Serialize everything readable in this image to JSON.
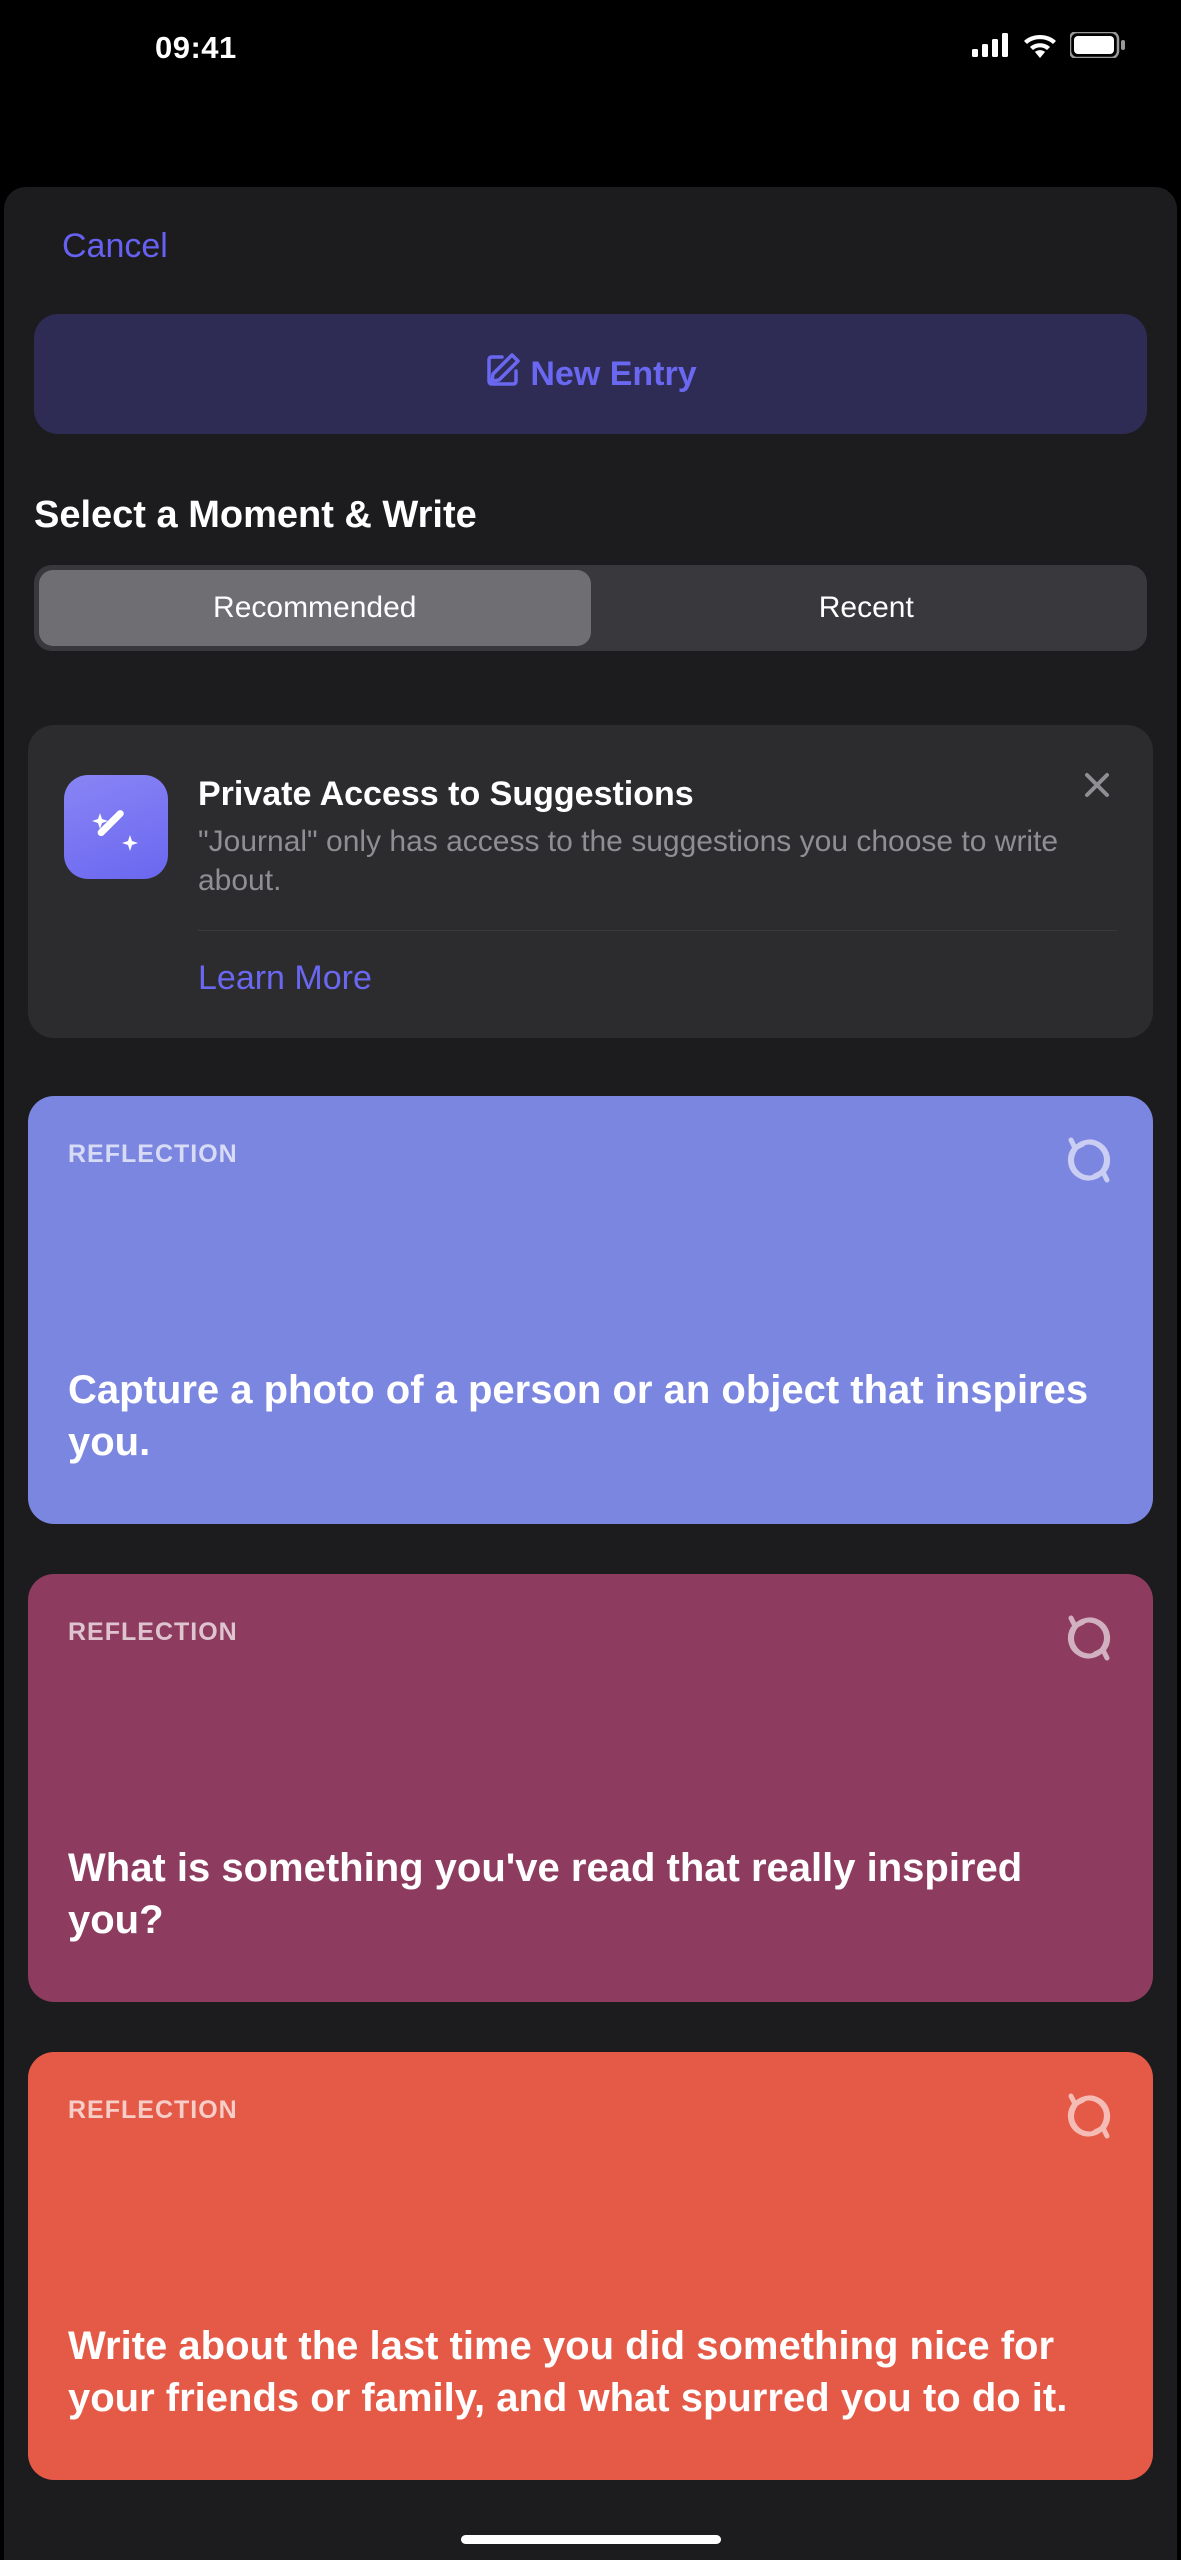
{
  "status": {
    "time": "09:41"
  },
  "sheet": {
    "cancel": "Cancel",
    "new_entry": "New Entry",
    "section_title": "Select a Moment & Write",
    "tabs": {
      "recommended": "Recommended",
      "recent": "Recent"
    },
    "notice": {
      "title": "Private Access to Suggestions",
      "desc": "\"Journal\" only has access to the suggestions you choose to write about.",
      "link": "Learn More"
    },
    "cards": [
      {
        "category": "REFLECTION",
        "prompt": "Capture a photo of a person or an object that inspires you."
      },
      {
        "category": "REFLECTION",
        "prompt": "What is something you've read that really inspired you?"
      },
      {
        "category": "REFLECTION",
        "prompt": "Write about the last time you did something nice for your friends or family, and what spurred you to do it."
      }
    ]
  }
}
